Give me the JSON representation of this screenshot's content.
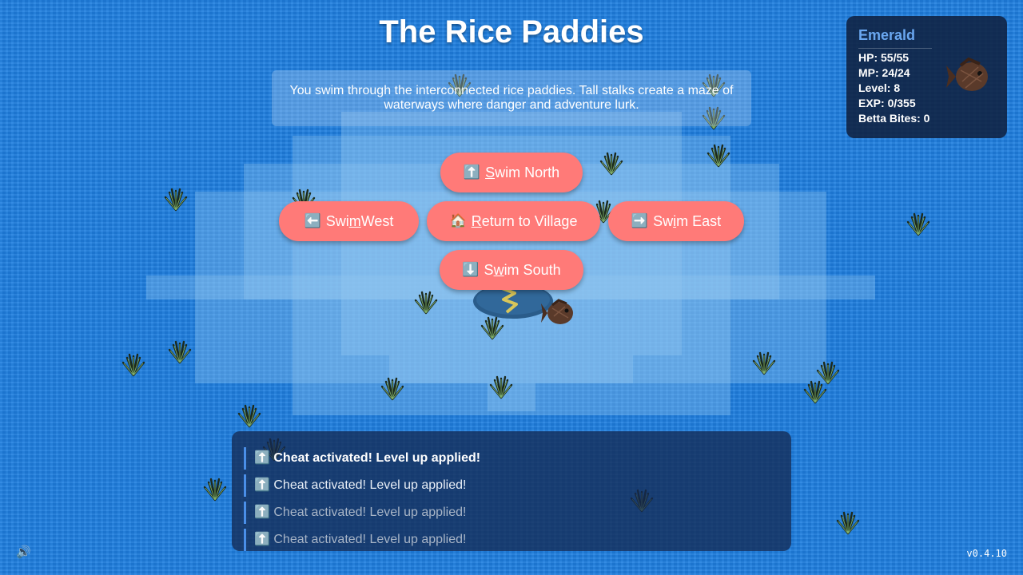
{
  "location": {
    "title": "The Rice Paddies",
    "description": "You swim through the interconnected rice paddies. Tall stalks create a maze of waterways where danger and adventure lurk."
  },
  "buttons": {
    "north": {
      "icon": "⬆️",
      "pre": "",
      "key": "S",
      "post": "wim North"
    },
    "west": {
      "icon": "⬅️",
      "pre": "Swi",
      "key": "m",
      "post": " West"
    },
    "village": {
      "icon": "🏠",
      "pre": "",
      "key": "R",
      "post": "eturn to Village"
    },
    "east": {
      "icon": "➡️",
      "pre": "Sw",
      "key": "i",
      "post": "m East"
    },
    "south": {
      "icon": "⬇️",
      "pre": "S",
      "key": "w",
      "post": "im South"
    }
  },
  "stats": {
    "name": "Emerald",
    "hp": "HP: 55/55",
    "mp": "MP: 24/24",
    "level": "Level: 8",
    "exp": "EXP: 0/355",
    "bites": "Betta Bites: 0"
  },
  "log": [
    {
      "icon": "⬆️",
      "text": "Cheat activated! Level up applied!"
    },
    {
      "icon": "⬆️",
      "text": "Cheat activated! Level up applied!"
    },
    {
      "icon": "⬆️",
      "text": "Cheat activated! Level up applied!"
    },
    {
      "icon": "⬆️",
      "text": "Cheat activated! Level up applied!"
    }
  ],
  "sound_icon": "🔊",
  "version": "v0.4.10",
  "colors": {
    "water": "#1e7fe0",
    "button": "#ff7a78",
    "name_accent": "#6aa7f0",
    "log_border": "#4a8fe8"
  },
  "icons": [
    "reed-icon",
    "fish-avatar-icon",
    "sound-icon",
    "island-icon"
  ]
}
